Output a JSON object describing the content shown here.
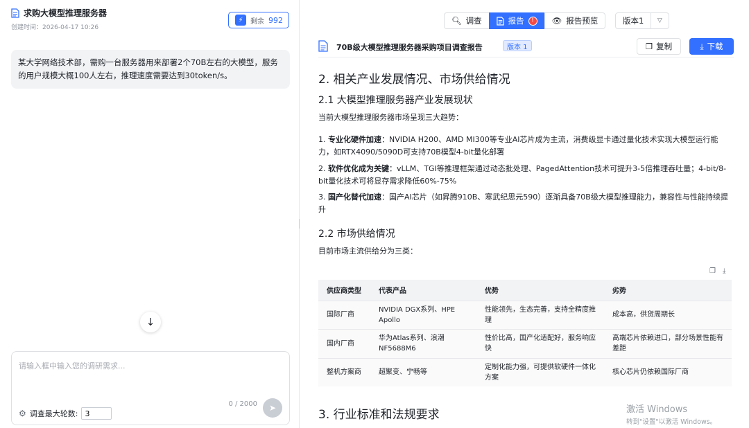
{
  "chat": {
    "title": "求购大模型推理服务器",
    "created": "创建时间：2026-04-17 10:26",
    "quota_label": "剩余",
    "quota_value": "992",
    "message": "某大学网络技术部，需购一台服务器用来部署2个70B左右的大模型，服务的用户规模大概100人左右，推理速度需要达到30token/s。",
    "input_placeholder": "请输入框中输入您的调研需求...",
    "rounds_label": "调查最大轮数:",
    "rounds_value": "3",
    "counter": "0 / 2000"
  },
  "tabs": [
    {
      "label": "调查",
      "icon": "search-icon"
    },
    {
      "label": "报告",
      "icon": "document-icon",
      "badge": "!"
    },
    {
      "label": "报告预览",
      "icon": "eye-icon"
    }
  ],
  "version_select": "版本1",
  "doc": {
    "title": "70B级大模型推理服务器采购项目调查报告",
    "version_tag": "版本 1",
    "copy_label": "复制",
    "download_label": "下载",
    "h2_1": "2. 相关产业发展情况、市场供给情况",
    "h3_1": "2.1 大模型推理服务器产业发展现状",
    "p_intro1": "当前大模型推理服务器市场呈现三大趋势：",
    "trends": [
      {
        "lead": "专业化硬件加速",
        "text": "：NVIDIA H200、AMD MI300等专业AI芯片成为主流，消费级显卡通过量化技术实现大模型运行能力，如RTX4090/5090D可支持70B模型4-bit量化部署",
        "num": "1. "
      },
      {
        "lead": "软件优化成为关键",
        "text": "：vLLM、TGI等推理框架通过动态批处理、PagedAttention技术可提升3-5倍推理吞吐量；4-bit/8-bit量化技术可将显存需求降低60%-75%",
        "num": "2. "
      },
      {
        "lead": "国产化替代加速",
        "text": "：国产AI芯片（如昇腾910B、寒武纪思元590）逐渐具备70B级大模型推理能力，兼容性与性能持续提升",
        "num": "3. "
      }
    ],
    "h3_2": "2.2 市场供给情况",
    "p_intro2": "目前市场主流供给分为三类：",
    "table": {
      "headers": [
        "供应商类型",
        "代表产品",
        "优势",
        "劣势"
      ],
      "rows": [
        [
          "国际厂商",
          "NVIDIA DGX系列、HPE Apollo",
          "性能领先，生态完善，支持全精度推理",
          "成本高，供货周期长"
        ],
        [
          "国内厂商",
          "华为Atlas系列、浪潮NF5688M6",
          "性价比高，国产化适配好，服务响应快",
          "高端芯片依赖进口，部分场景性能有差距"
        ],
        [
          "整机方案商",
          "超聚变、宁畅等",
          "定制化能力强，可提供软硬件一体化方案",
          "核心芯片仍依赖国际厂商"
        ]
      ]
    },
    "h2_2": "3. 行业标准和法规要求"
  },
  "watermark": {
    "line1": "激活 Windows",
    "line2": "转到\"设置\"以激活 Windows。"
  }
}
